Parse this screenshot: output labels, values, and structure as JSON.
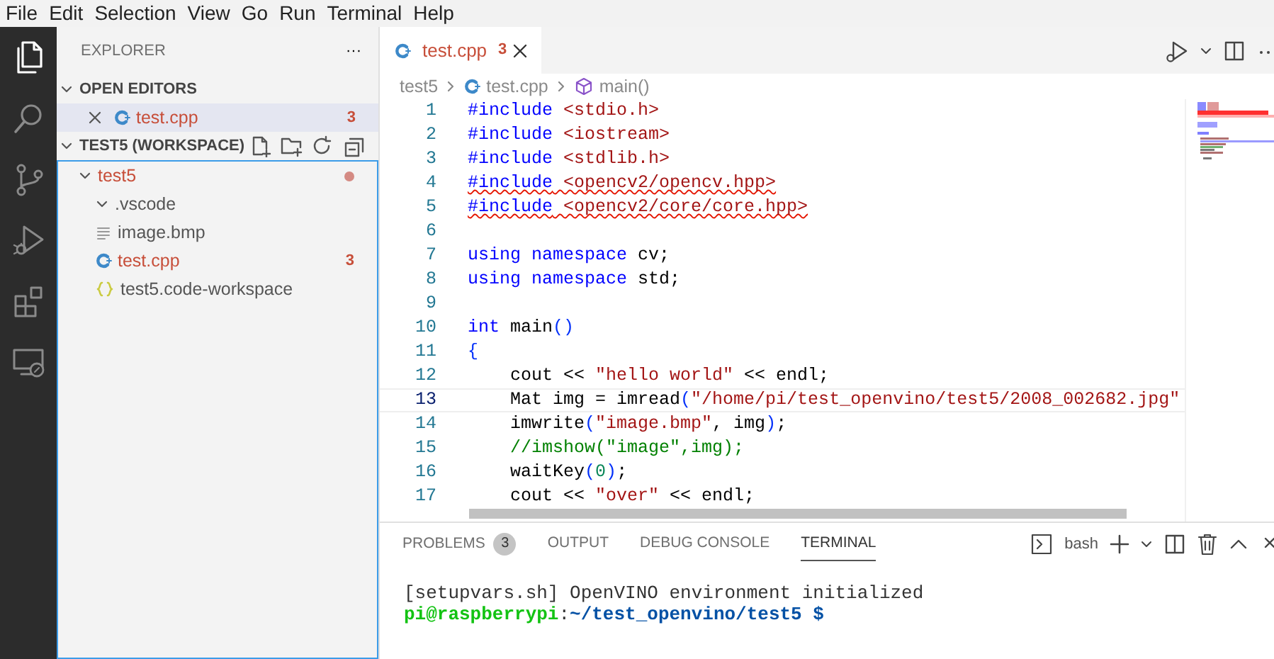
{
  "menu": [
    "File",
    "Edit",
    "Selection",
    "View",
    "Go",
    "Run",
    "Terminal",
    "Help"
  ],
  "activity_bar": [
    {
      "kind": "files",
      "selected": true
    },
    {
      "kind": "search",
      "selected": false
    },
    {
      "kind": "source-control",
      "selected": false
    },
    {
      "kind": "run-debug",
      "selected": false
    },
    {
      "kind": "extensions",
      "selected": false
    },
    {
      "kind": "remote",
      "selected": false
    }
  ],
  "sidebar": {
    "title": "EXPLORER",
    "more": "···",
    "open_editors": {
      "title": "OPEN EDITORS",
      "expanded": true,
      "items": [
        {
          "name": "test.cpp",
          "kind": "cpp",
          "errors": "3",
          "error": true,
          "selected": true
        }
      ]
    },
    "workspace": {
      "title": "TEST5 (WORKSPACE)",
      "expanded": true,
      "focused": true,
      "tree": [
        {
          "name": "test5",
          "kind": "folder",
          "expanded": true,
          "error": true,
          "modified": true,
          "children": [
            {
              "name": ".vscode",
              "kind": "folder",
              "expanded": true,
              "error": false,
              "modified": false
            },
            {
              "name": "image.bmp",
              "kind": "text",
              "error": false,
              "modified": false
            },
            {
              "name": "test.cpp",
              "kind": "cpp",
              "errors": "3",
              "error": true,
              "modified": false
            },
            {
              "name": "test5.code-workspace",
              "kind": "json",
              "error": false,
              "modified": false
            }
          ]
        }
      ]
    }
  },
  "editor": {
    "tabs": [
      {
        "name": "test.cpp",
        "kind": "cpp",
        "errors": "3",
        "error": true,
        "selected": true
      }
    ],
    "breadcrumb": [
      {
        "text": "test5",
        "kind": "folder"
      },
      {
        "text": "test.cpp",
        "kind": "cpp"
      },
      {
        "text": "main()",
        "kind": "symbol"
      }
    ],
    "lines": [
      {
        "number": "1",
        "squiggle": false,
        "current": false,
        "tokens": [
          {
            "text": "#include",
            "kind": "kw"
          },
          {
            "text": " <stdio.h>",
            "kind": "str"
          }
        ]
      },
      {
        "number": "2",
        "squiggle": false,
        "current": false,
        "tokens": [
          {
            "text": "#include",
            "kind": "kw"
          },
          {
            "text": " <iostream>",
            "kind": "str"
          }
        ]
      },
      {
        "number": "3",
        "squiggle": false,
        "current": false,
        "tokens": [
          {
            "text": "#include",
            "kind": "kw"
          },
          {
            "text": " <stdlib.h>",
            "kind": "str"
          }
        ]
      },
      {
        "number": "4",
        "squiggle": true,
        "current": false,
        "tokens": [
          {
            "text": "#include",
            "kind": "kw"
          },
          {
            "text": " <opencv2/opencv.hpp>",
            "kind": "str"
          }
        ]
      },
      {
        "number": "5",
        "squiggle": true,
        "current": false,
        "tokens": [
          {
            "text": "#include",
            "kind": "kw"
          },
          {
            "text": " <opencv2/core/core.hpp>",
            "kind": "str"
          }
        ]
      },
      {
        "number": "6",
        "current": false
      },
      {
        "number": "7",
        "squiggle": false,
        "current": false,
        "tokens": [
          {
            "text": "using namespace",
            "kind": "kw"
          },
          {
            "text": " cv;",
            "kind": "plain"
          }
        ]
      },
      {
        "number": "8",
        "squiggle": false,
        "current": false,
        "tokens": [
          {
            "text": "using namespace",
            "kind": "kw"
          },
          {
            "text": " std;",
            "kind": "plain"
          }
        ]
      },
      {
        "number": "9",
        "current": false
      },
      {
        "number": "10",
        "squiggle": false,
        "current": false,
        "tokens": [
          {
            "text": "int",
            "kind": "kw"
          },
          {
            "text": " main",
            "kind": "plain"
          },
          {
            "text": "()",
            "kind": "bracket"
          }
        ]
      },
      {
        "number": "11",
        "squiggle": false,
        "current": false,
        "tokens": [
          {
            "text": "{",
            "kind": "bracket"
          }
        ]
      },
      {
        "number": "12",
        "squiggle": false,
        "current": false,
        "tokens": [
          {
            "text": "    cout << ",
            "kind": "plain"
          },
          {
            "text": "\"hello world\"",
            "kind": "str"
          },
          {
            "text": " << endl;",
            "kind": "plain"
          }
        ]
      },
      {
        "number": "13",
        "squiggle": false,
        "current": true,
        "tokens": [
          {
            "text": "    Mat img = imread",
            "kind": "plain"
          },
          {
            "text": "(",
            "kind": "bracket"
          },
          {
            "text": "\"/home/pi/test_openvino/test5/2008_002682.jpg\"",
            "kind": "str"
          }
        ]
      },
      {
        "number": "14",
        "squiggle": false,
        "current": false,
        "tokens": [
          {
            "text": "    imwrite",
            "kind": "plain"
          },
          {
            "text": "(",
            "kind": "bracket"
          },
          {
            "text": "\"image.bmp\"",
            "kind": "str"
          },
          {
            "text": ", img",
            "kind": "plain"
          },
          {
            "text": ")",
            "kind": "bracket"
          },
          {
            "text": ";",
            "kind": "plain"
          }
        ]
      },
      {
        "number": "15",
        "squiggle": false,
        "current": false,
        "tokens": [
          {
            "text": "    //imshow(\"image\",img);",
            "kind": "cmt"
          }
        ]
      },
      {
        "number": "16",
        "squiggle": false,
        "current": false,
        "tokens": [
          {
            "text": "    waitKey",
            "kind": "plain"
          },
          {
            "text": "(",
            "kind": "bracket"
          },
          {
            "text": "0",
            "kind": "num"
          },
          {
            "text": ")",
            "kind": "bracket"
          },
          {
            "text": ";",
            "kind": "plain"
          }
        ]
      },
      {
        "number": "17",
        "squiggle": false,
        "current": false,
        "tokens": [
          {
            "text": "    cout << ",
            "kind": "plain"
          },
          {
            "text": "\"over\"",
            "kind": "str"
          },
          {
            "text": " << endl;",
            "kind": "plain"
          }
        ]
      }
    ]
  },
  "panel": {
    "tabs": [
      {
        "label": "PROBLEMS",
        "badge": "3",
        "selected": false
      },
      {
        "label": "OUTPUT",
        "selected": false
      },
      {
        "label": "DEBUG CONSOLE",
        "selected": false
      },
      {
        "label": "TERMINAL",
        "selected": true
      }
    ],
    "shell": "bash",
    "terminal": [
      {
        "tokens": [
          {
            "text": "[setupvars.sh] OpenVINO environment initialized",
            "kind": "plain"
          }
        ]
      },
      {
        "tokens": [
          {
            "text": "pi@raspberrypi",
            "kind": "user"
          },
          {
            "text": ":",
            "kind": "plain"
          },
          {
            "text": "~/test_openvino/test5 $",
            "kind": "path"
          }
        ]
      }
    ]
  }
}
